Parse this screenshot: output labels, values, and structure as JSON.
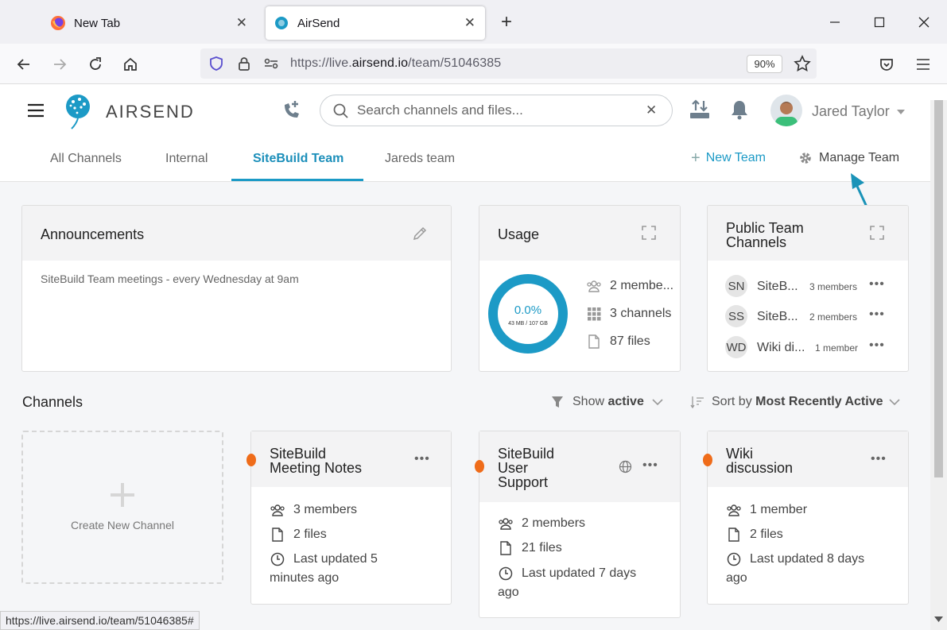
{
  "browser": {
    "tabs": [
      {
        "title": "New Tab"
      },
      {
        "title": "AirSend"
      }
    ],
    "url_scheme": "https://live.",
    "url_domain": "airsend.io",
    "url_path": "/team/51046385",
    "zoom": "90%"
  },
  "app": {
    "brand": "AIRSEND",
    "search_placeholder": "Search channels and files...",
    "user_name": "Jared Taylor",
    "colors": {
      "accent": "#1c9ac6",
      "unread": "#ef6c1a"
    }
  },
  "team_tabs": [
    "All Channels",
    "Internal",
    "SiteBuild Team",
    "Jareds team"
  ],
  "actions": {
    "new_team": "New Team",
    "manage_team": "Manage Team"
  },
  "announcements": {
    "title": "Announcements",
    "text": "SiteBuild Team meetings - every Wednesday at 9am"
  },
  "usage": {
    "title": "Usage",
    "percent": "0.0%",
    "storage": "43 MB / 107 GB",
    "members": "2 membe...",
    "channels": "3 channels",
    "files": "87 files"
  },
  "public_channels": {
    "title_line1": "Public Team",
    "title_line2": "Channels",
    "items": [
      {
        "initials": "SN",
        "name": "SiteB...",
        "members": "3 members"
      },
      {
        "initials": "SS",
        "name": "SiteB...",
        "members": "2 members"
      },
      {
        "initials": "WD",
        "name": "Wiki di...",
        "members": "1 member"
      }
    ]
  },
  "channels": {
    "title": "Channels",
    "filter_prefix": "Show",
    "filter_value": "active",
    "sort_prefix": "Sort by",
    "sort_value": "Most Recently Active",
    "create_label": "Create New Channel",
    "cards": [
      {
        "title_line1": "SiteBuild",
        "title_line2": "Meeting Notes",
        "title_line3": "",
        "members": "3 members",
        "files": "2 files",
        "updated_line1": "Last updated 5",
        "updated_line2": "minutes ago"
      },
      {
        "title_line1": "SiteBuild",
        "title_line2": "User",
        "title_line3": "Support",
        "members": "2 members",
        "files": "21 files",
        "updated_line1": "Last updated 7 days",
        "updated_line2": "ago"
      },
      {
        "title_line1": "Wiki",
        "title_line2": "discussion",
        "title_line3": "",
        "members": "1 member",
        "files": "2 files",
        "updated_line1": "Last updated 8 days",
        "updated_line2": "ago"
      }
    ]
  },
  "status_url": "https://live.airsend.io/team/51046385#"
}
